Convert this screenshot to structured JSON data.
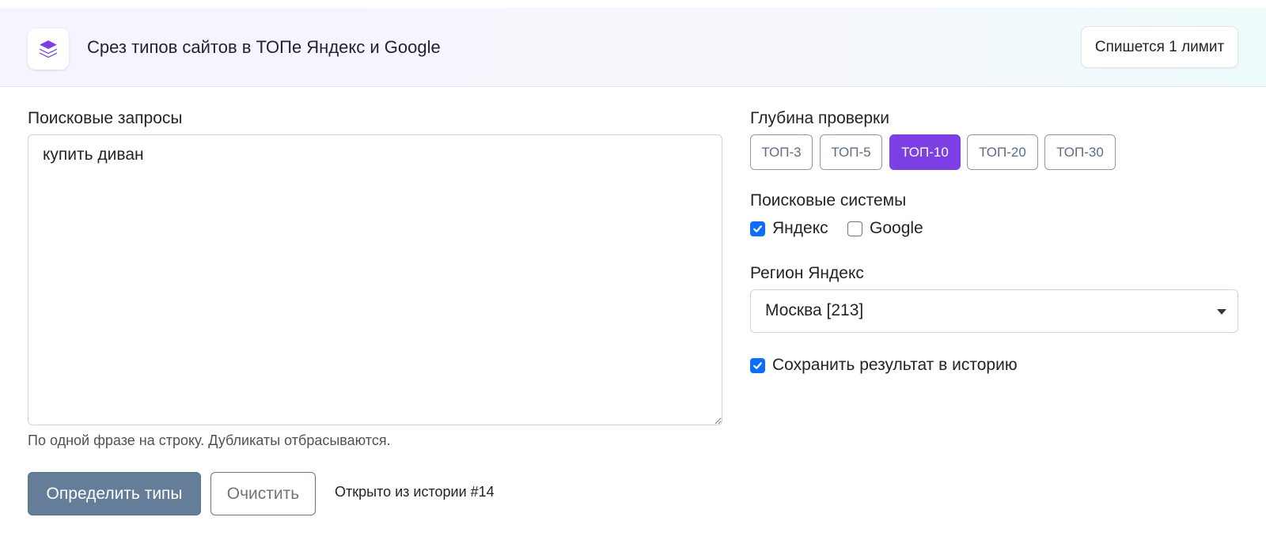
{
  "header": {
    "title": "Срез типов сайтов в ТОПе Яндекс и Google",
    "icon": "layers-icon",
    "limit_badge": "Спишется 1 лимит"
  },
  "queries": {
    "label": "Поисковые запросы",
    "value": "купить диван",
    "help": "По одной фразе на строку. Дубликаты отбрасываются."
  },
  "actions": {
    "submit_label": "Определить типы",
    "clear_label": "Очистить",
    "history_note": "Открыто из истории #14"
  },
  "depth": {
    "label": "Глубина проверки",
    "options": [
      "ТОП-3",
      "ТОП-5",
      "ТОП-10",
      "ТОП-20",
      "ТОП-30"
    ],
    "selected": "ТОП-10"
  },
  "engines": {
    "label": "Поисковые системы",
    "yandex": {
      "label": "Яндекс",
      "checked": true
    },
    "google": {
      "label": "Google",
      "checked": false
    }
  },
  "region": {
    "label": "Регион Яндекс",
    "value": "Москва [213]"
  },
  "save_history": {
    "label": "Сохранить результат в историю",
    "checked": true
  },
  "colors": {
    "accent": "#7b3fe4",
    "primary_button": "#647d98",
    "checkbox": "#0d6efd"
  }
}
